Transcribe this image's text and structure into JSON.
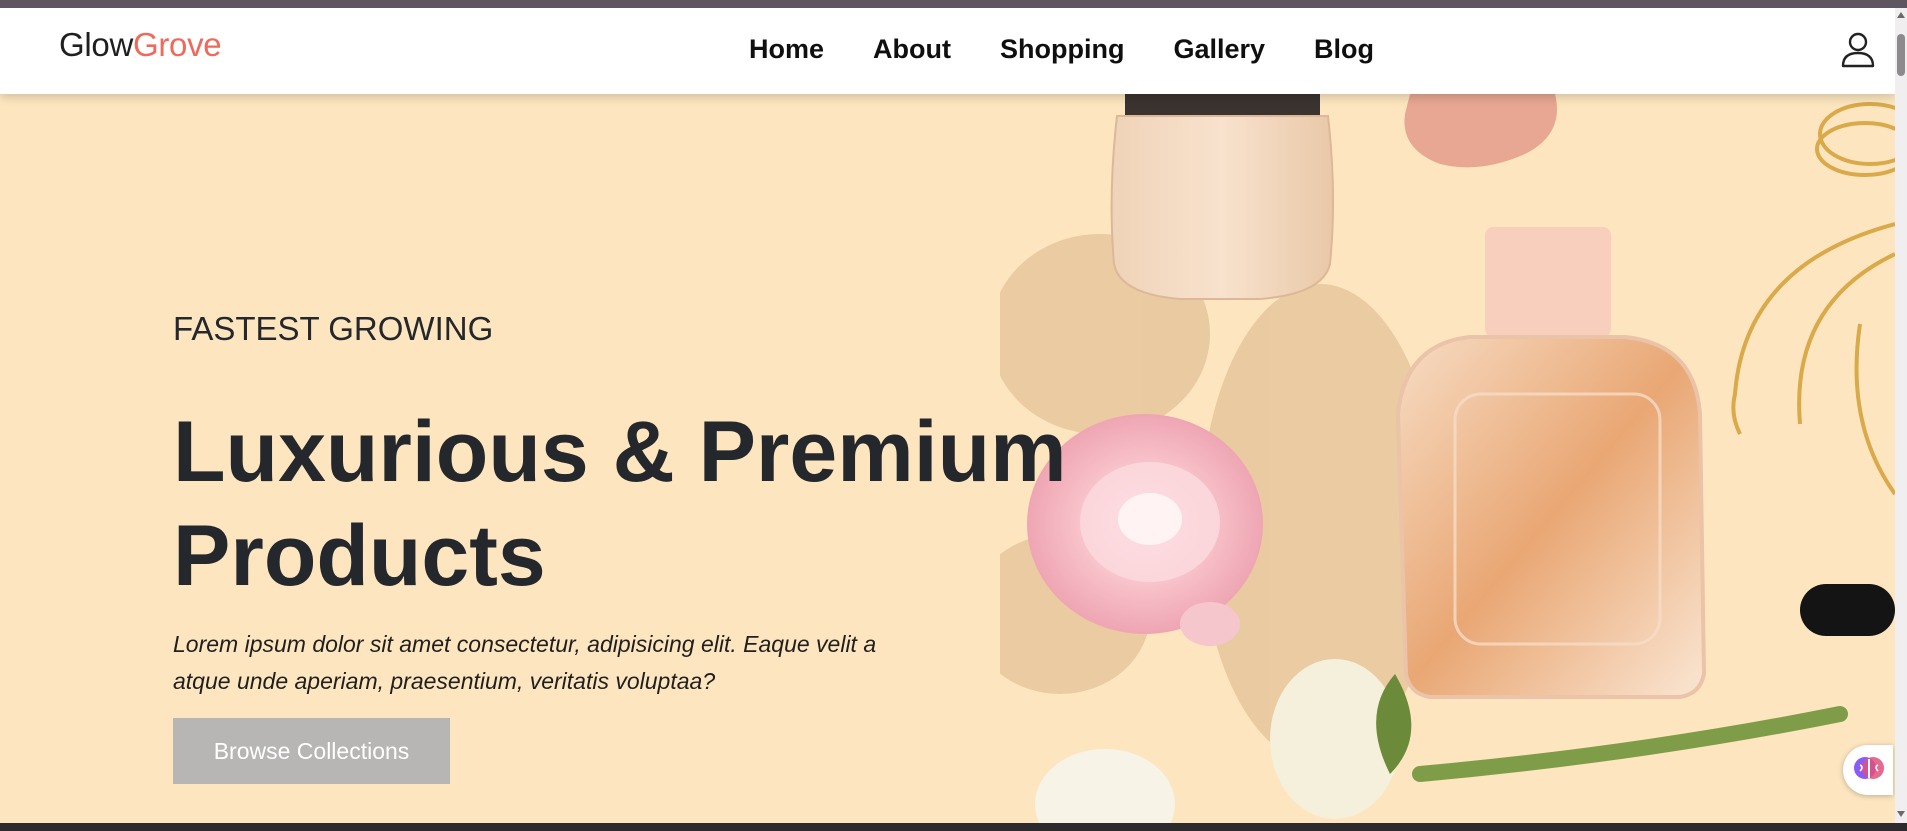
{
  "nav": {
    "brand_first": "Glow",
    "brand_second": "Grove",
    "links": [
      "Home",
      "About",
      "Shopping",
      "Gallery",
      "Blog"
    ],
    "account_icon": "user-icon"
  },
  "hero": {
    "eyebrow": "FASTEST GROWING",
    "headline": "Luxurious & Premium Products",
    "description": "Lorem ipsum dolor sit amet consectetur, adipisicing elit. Eaque velit a atque unde aperiam, praesentium, veritatis voluptaa?",
    "cta_label": "Browse Collections",
    "visual": "cosmetics-flatlay-image"
  },
  "widget": {
    "icon": "brain-icon"
  },
  "colors": {
    "brand_accent": "#ef6a5b",
    "hero_background": "#fde6bf",
    "text_dark": "#24272b",
    "cta_background": "#b8b6b4"
  }
}
